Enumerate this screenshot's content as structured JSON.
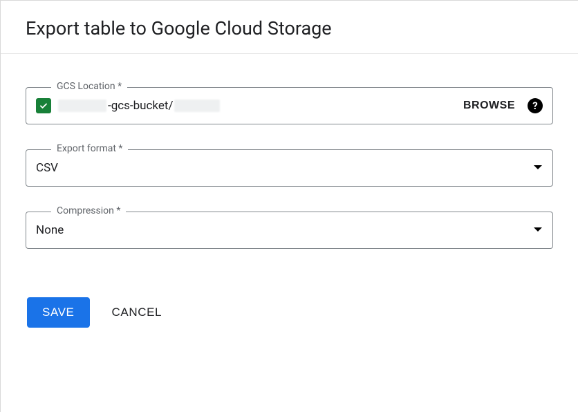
{
  "dialog": {
    "title": "Export table to Google Cloud Storage"
  },
  "gcs": {
    "label": "GCS Location *",
    "path_mid": "-gcs-bucket/",
    "browse": "BROWSE"
  },
  "export_format": {
    "label": "Export format *",
    "value": "CSV"
  },
  "compression": {
    "label": "Compression *",
    "value": "None"
  },
  "actions": {
    "save": "SAVE",
    "cancel": "CANCEL"
  }
}
